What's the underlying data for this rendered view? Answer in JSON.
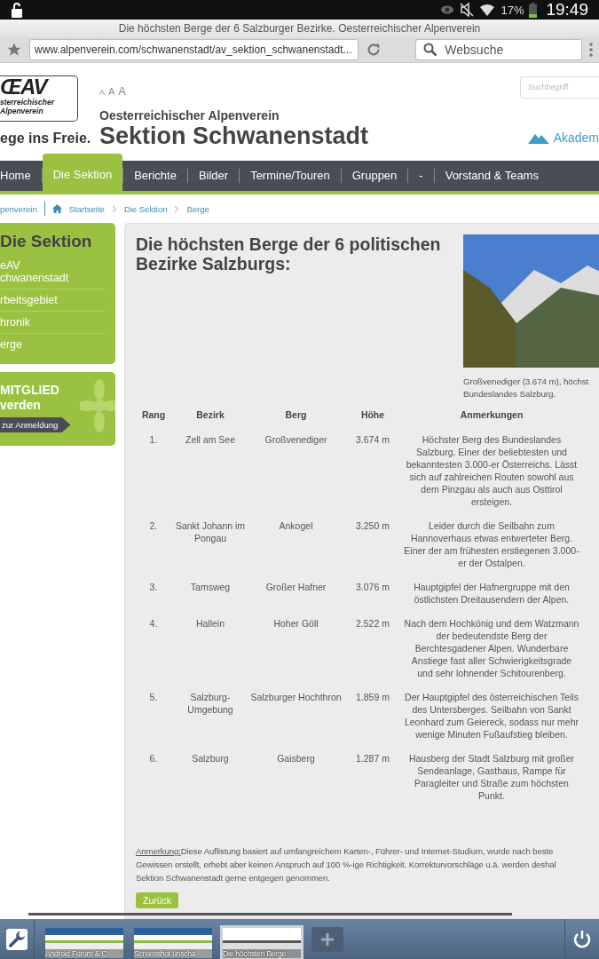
{
  "status_bar": {
    "battery": "17%",
    "time": "19:49"
  },
  "browser": {
    "title": "Die höchsten Berge der 6 Salzburger Bezirke. Oesterreichischer Alpenverein",
    "url": "www.alpenverein.com/schwanenstadt/av_sektion_schwanenstadt...",
    "search_placeholder": "Websuche"
  },
  "header": {
    "logo_mark": "ŒAV",
    "logo_lines": [
      "sterreichischer",
      "Alpenverein"
    ],
    "slogan": "ege ins Freie.",
    "font_sizes": [
      "A",
      "A",
      "A"
    ],
    "org": "Oesterreichischer Alpenverein",
    "title": "Sektion Schwanenstadt",
    "search_placeholder": "Suchbegriff",
    "link": "Akadem"
  },
  "nav": [
    {
      "label": "Home",
      "selected": false
    },
    {
      "label": "Die Sektion",
      "selected": true
    },
    {
      "label": "Berichte",
      "selected": false
    },
    {
      "label": "Bilder",
      "selected": false
    },
    {
      "label": "Termine/Touren",
      "selected": false
    },
    {
      "label": "Gruppen",
      "selected": false
    },
    {
      "label": "-",
      "selected": false
    },
    {
      "label": "Vorstand & Teams",
      "selected": false
    }
  ],
  "breadcrumb": {
    "root": "penverein",
    "items": [
      "Startseite",
      "Die Sektion",
      "Berge"
    ]
  },
  "sidebar": {
    "title": "Die Sektion",
    "items": [
      {
        "lines": [
          "eAV",
          "chwanenstadt"
        ]
      },
      {
        "lines": [
          "rbeitsgebiet"
        ]
      },
      {
        "lines": [
          "hronik"
        ]
      },
      {
        "lines": [
          "erge"
        ]
      }
    ],
    "promo": {
      "lines": [
        "MITGLIED",
        "verden"
      ],
      "button": "zur Anmeldung"
    }
  },
  "content": {
    "heading": "Die höchsten Berge der 6 politischen Bezirke Salzburgs:",
    "caption_lines": [
      "Großvenediger (3.674 m), höchst",
      "Bundeslandes Salzburg."
    ],
    "table": {
      "columns": [
        "Rang",
        "Bezirk",
        "Berg",
        "Höhe",
        "Anmerkungen"
      ],
      "rows": [
        [
          "1.",
          "Zell am See",
          "Großvenediger",
          "3.674 m",
          "Höchster Berg des Bundeslandes Salzburg. Einer der beliebtesten und bekanntesten 3.000-er Österreichs. Lässt sich auf zahlreichen Routen sowohl aus dem Pinzgau als auch aus Osttirol ersteigen."
        ],
        [
          "2.",
          "Sankt Johann im Pongau",
          "Ankogel",
          "3.250 m",
          "Leider durch die Seilbahn zum Hannoverhaus etwas entwerteter Berg. Einer der am frühesten erstiegenen 3.000-er der Ostalpen."
        ],
        [
          "3.",
          "Tamsweg",
          "Großer Hafner",
          "3.076 m",
          "Hauptgipfel der Hafnergruppe mit den östlichsten Dreitausendern der Alpen."
        ],
        [
          "4.",
          "Hallein",
          "Hoher Göll",
          "2.522 m",
          "Nach dem Hochkönig und dem Watzmann der bedeutendste Berg der Berchtesgadener Alpen. Wunderbare Anstiege fast aller Schwierigkeitsgrade und sehr lohnender Schitourenberg."
        ],
        [
          "5.",
          "Salzburg-Umgebung",
          "Salzburger Hochthron",
          "1.859 m",
          "Der Hauptgipfel des österreichischen Teils des Untersberges. Seilbahn von Sankt Leonhard zum Geiereck, sodass nur mehr wenige Minuten Fußaufstieg bleiben."
        ],
        [
          "6.",
          "Salzburg",
          "Gaisberg",
          "1.287 m",
          "Hausberg der Stadt Salzburg mit großer Sendeanlage, Gasthaus, Rampe für Paragleiter und Straße zum höchsten Punkt."
        ]
      ]
    },
    "note_label": "Anmerkung:",
    "note_lines": [
      "Diese Auflistung basiert auf umfangreichem Karten-, Führer- und Internet-Studium, wurde nach beste",
      "Gewissen erstellt, erhebt aber keinen Anspruch auf 100 %-ige Richtigkeit. Korrekturvorschläge u.ä. werden deshal",
      "Sektion Schwanenstadt gerne entgegen genommen."
    ],
    "back_button": "Zurück"
  },
  "taskbar": {
    "tabs": [
      {
        "label": "Android Forum & C",
        "selected": false
      },
      {
        "label": "Screenshot unscha",
        "selected": false
      },
      {
        "label": "Die höchsten Berge",
        "selected": true
      }
    ]
  }
}
